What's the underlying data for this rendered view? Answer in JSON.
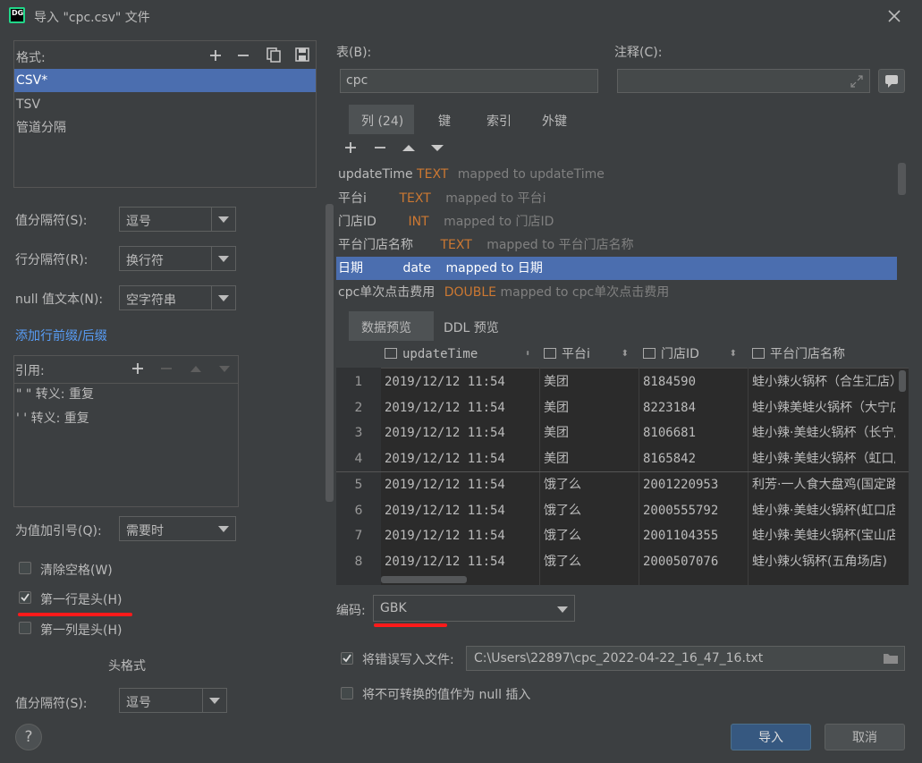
{
  "window": {
    "title": "导入 \"cpc.csv\" 文件",
    "logo": "DG"
  },
  "left": {
    "formats": {
      "label": "格式:",
      "items": [
        "CSV*",
        "TSV",
        "管道分隔"
      ],
      "selected_index": 0
    },
    "value_sep": {
      "label": "值分隔符(S):",
      "value": "逗号"
    },
    "row_sep": {
      "label": "行分隔符(R):",
      "value": "换行符"
    },
    "null_text": {
      "label": "null 值文本(N):",
      "value": "空字符串"
    },
    "add_prefix_link": "添加行前缀/后缀",
    "quotes": {
      "label": "引用:",
      "items": [
        "\" \"  转义: 重复",
        "' '  转义: 重复"
      ]
    },
    "quote_values": {
      "label": "为值加引号(Q):",
      "value": "需要时"
    },
    "trim_spaces": {
      "label": "清除空格(W)",
      "checked": false
    },
    "first_row_header": {
      "label": "第一行是头(H)",
      "checked": true
    },
    "first_col_header": {
      "label": "第一列是头(H)",
      "checked": false
    },
    "header_format_label": "头格式",
    "header_value_sep": {
      "label": "值分隔符(S):",
      "value": "逗号"
    }
  },
  "right": {
    "table": {
      "label": "表(B):",
      "value": "cpc"
    },
    "comment": {
      "label": "注释(C):",
      "value": ""
    },
    "tabs": [
      "列 (24)",
      "键",
      "索引",
      "外键"
    ],
    "active_tab": 0,
    "columns": [
      {
        "name": "updateTime",
        "type": "TEXT",
        "mapping": "mapped to updateTime"
      },
      {
        "name": "平台i",
        "type": "TEXT",
        "mapping": "mapped to 平台i"
      },
      {
        "name": "门店ID",
        "type": "INT",
        "mapping": "mapped to 门店ID"
      },
      {
        "name": "平台门店名称",
        "type": "TEXT",
        "mapping": "mapped to 平台门店名称"
      },
      {
        "name": "日期",
        "type": "date",
        "mapping": "mapped to 日期"
      },
      {
        "name": "cpc单次点击费用",
        "type": "DOUBLE",
        "mapping": "mapped to cpc单次点击费用"
      }
    ],
    "selected_column": 4,
    "preview_tabs": [
      "数据预览",
      "DDL 预览"
    ],
    "active_preview_tab": 0,
    "grid": {
      "headers": [
        "updateTime",
        "平台i",
        "门店ID",
        "平台门店名称"
      ],
      "rows": [
        [
          "1",
          "2019/12/12 11:54",
          "美团",
          "8184590",
          "蛙小辣火锅杯（合生汇店）"
        ],
        [
          "2",
          "2019/12/12 11:54",
          "美团",
          "8223184",
          "蛙小辣美蛙火锅杯（大宁店）"
        ],
        [
          "3",
          "2019/12/12 11:54",
          "美团",
          "8106681",
          "蛙小辣·美蛙火锅杯（长宁店）"
        ],
        [
          "4",
          "2019/12/12 11:54",
          "美团",
          "8165842",
          "蛙小辣·美蛙火锅杯（虹口店）"
        ],
        [
          "5",
          "2019/12/12 11:54",
          "饿了么",
          "2001220953",
          "利芳·一人食大盘鸡(国定路店)"
        ],
        [
          "6",
          "2019/12/12 11:54",
          "饿了么",
          "2000555792",
          "蛙小辣·美蛙火锅杯(虹口店)"
        ],
        [
          "7",
          "2019/12/12 11:54",
          "饿了么",
          "2001104355",
          "蛙小辣·美蛙火锅杯(宝山店)"
        ],
        [
          "8",
          "2019/12/12 11:54",
          "饿了么",
          "2000507076",
          "蛙小辣火锅杯(五角场店)"
        ]
      ]
    },
    "encoding": {
      "label": "编码:",
      "value": "GBK"
    },
    "write_errors": {
      "label": "将错误写入文件:",
      "checked": true,
      "path": "C:\\Users\\22897\\cpc_2022-04-22_16_47_16.txt"
    },
    "null_insert": {
      "label": "将不可转换的值作为 null 插入",
      "checked": false
    }
  },
  "footer": {
    "help": "?",
    "import_label": "导入",
    "cancel_label": "取消"
  },
  "colors": {
    "accent": "#4b6eaf",
    "type_color": "#cc7832",
    "link": "#589df6",
    "annotation_red": "#ff1a1a"
  }
}
